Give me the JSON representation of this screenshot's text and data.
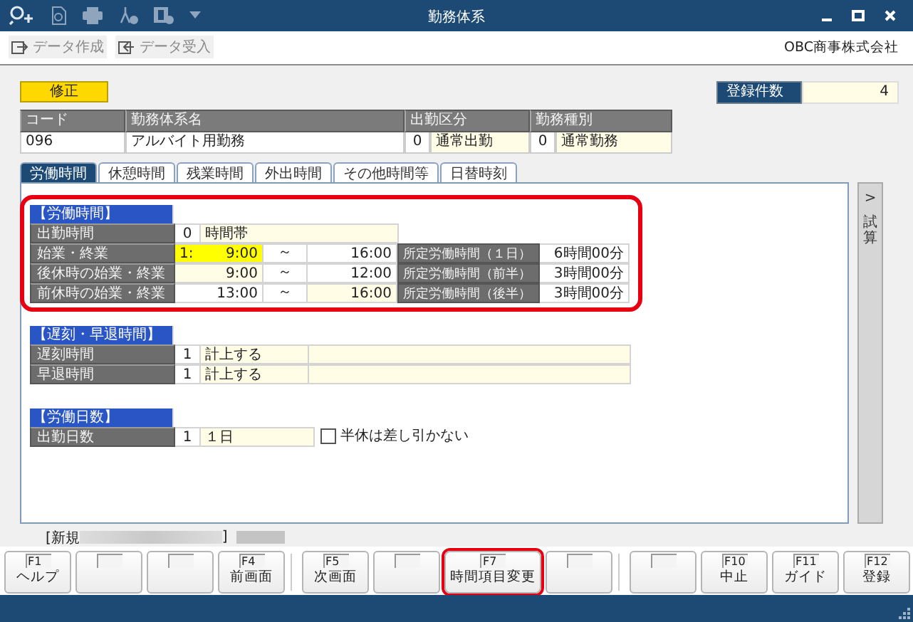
{
  "window": {
    "title": "勤務体系"
  },
  "toolbar": {
    "buttons": [
      {
        "label": "データ作成",
        "kind": "export",
        "disabled": true
      },
      {
        "label": "データ受入",
        "kind": "import",
        "disabled": true
      }
    ],
    "company": "OBC商事株式会社"
  },
  "mode_badge": "修正",
  "record_count": {
    "label": "登録件数",
    "value": "4"
  },
  "header_table": {
    "columns": [
      {
        "label": "コード"
      },
      {
        "label": "勤務体系名"
      },
      {
        "label": "出勤区分"
      },
      {
        "label": "勤務種別"
      }
    ],
    "row": {
      "code": "096",
      "name": "アルバイト用勤務",
      "attendance_code": "0",
      "attendance": "通常出勤",
      "work_type_code": "0",
      "work_type": "通常勤務"
    }
  },
  "tabs": [
    {
      "label": "労働時間",
      "selected": true
    },
    {
      "label": "休憩時間",
      "selected": false
    },
    {
      "label": "残業時間",
      "selected": false
    },
    {
      "label": "外出時間",
      "selected": false
    },
    {
      "label": "その他時間等",
      "selected": false
    },
    {
      "label": "日替時刻",
      "selected": false
    }
  ],
  "side_tab": {
    "arrow": ">",
    "label": "試算"
  },
  "sections": [
    {
      "title": "【労働時間】",
      "highlighted": true,
      "rows": [
        {
          "kind": "select",
          "label": "出勤時間",
          "code": "0",
          "value": "時間帯"
        },
        {
          "kind": "range",
          "label": "始業・終業",
          "pattern": "1:",
          "start": "9:00",
          "separator": "～",
          "end": "16:00",
          "start_focused": true,
          "end_editable": false,
          "sub_label": "所定労働時間（１日）",
          "sub_value": "6時間00分"
        },
        {
          "kind": "range",
          "label": "後休時の始業・終業",
          "start": "9:00",
          "separator": "～",
          "end": "12:00",
          "start_focused": false,
          "start_editable": true,
          "end_editable": false,
          "sub_label": "所定労働時間（前半）",
          "sub_value": "3時間00分"
        },
        {
          "kind": "range",
          "label": "前休時の始業・終業",
          "start": "13:00",
          "separator": "～",
          "end": "16:00",
          "start_focused": false,
          "start_editable": false,
          "end_editable": true,
          "sub_label": "所定労働時間（後半）",
          "sub_value": "3時間00分"
        }
      ]
    },
    {
      "title": "【遅刻・早退時間】",
      "highlighted": false,
      "rows": [
        {
          "kind": "option",
          "label": "遅刻時間",
          "code": "1",
          "value": "計上する"
        },
        {
          "kind": "option",
          "label": "早退時間",
          "code": "1",
          "value": "計上する"
        }
      ]
    },
    {
      "title": "【労働日数】",
      "highlighted": false,
      "rows": [
        {
          "kind": "count",
          "label": "出勤日数",
          "code": "1",
          "value": "１日",
          "option": {
            "label": "半休は差し引かない",
            "checked": false
          }
        }
      ]
    }
  ],
  "record_note": {
    "prefix": "[新規",
    "suffix": "]"
  },
  "function_keys": [
    {
      "key": "F1",
      "label": "ヘルプ",
      "highlighted": false
    },
    {
      "highlighted": false
    },
    {
      "highlighted": false
    },
    {
      "key": "F4",
      "label": "前画面",
      "highlighted": false
    },
    {
      "key": "F5",
      "label": "次画面",
      "highlighted": false
    },
    {
      "highlighted": false
    },
    {
      "key": "F7",
      "label": "時間項目変更",
      "highlighted": true
    },
    {
      "highlighted": false
    },
    {
      "highlighted": false
    },
    {
      "key": "F10",
      "label": "中止",
      "highlighted": false
    },
    {
      "key": "F11",
      "label": "ガイド",
      "highlighted": false
    },
    {
      "key": "F12",
      "label": "登録",
      "highlighted": false
    }
  ]
}
